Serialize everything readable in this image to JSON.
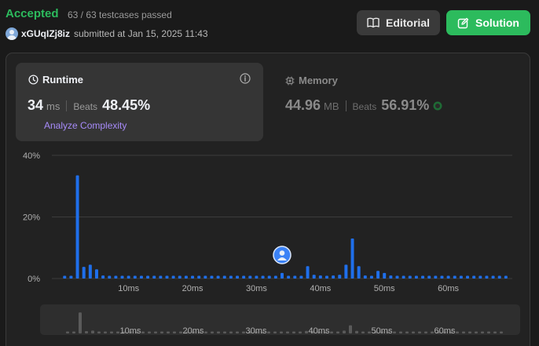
{
  "header": {
    "status": "Accepted",
    "testcases": "63 / 63 testcases passed",
    "username": "xGUqIZj8iz",
    "submitted_text": "submitted at Jan 15, 2025 11:43",
    "editorial_label": "Editorial",
    "solution_label": "Solution"
  },
  "runtime": {
    "title": "Runtime",
    "value": "34",
    "unit": "ms",
    "beats_label": "Beats",
    "beats": "48.45%",
    "analyze_label": "Analyze Complexity"
  },
  "memory": {
    "title": "Memory",
    "value": "44.96",
    "unit": "MB",
    "beats_label": "Beats",
    "beats": "56.91%"
  },
  "colors": {
    "accent_green": "#2cbb5d",
    "bar_blue": "#1f6feb",
    "analyze_purple": "#a78bfa"
  },
  "chart_data": {
    "type": "bar",
    "x": [
      0,
      1,
      2,
      3,
      4,
      5,
      6,
      7,
      8,
      9,
      10,
      11,
      12,
      13,
      14,
      15,
      16,
      17,
      18,
      19,
      20,
      21,
      22,
      23,
      24,
      25,
      26,
      27,
      28,
      29,
      30,
      31,
      32,
      33,
      34,
      35,
      36,
      37,
      38,
      39,
      40,
      41,
      42,
      43,
      44,
      45,
      46,
      47,
      48,
      49,
      50,
      51,
      52,
      53,
      54,
      55,
      56,
      57,
      58,
      59,
      60,
      61,
      62,
      63,
      64,
      65,
      66,
      67,
      68,
      69
    ],
    "values": [
      0.9,
      0.9,
      33.5,
      3.8,
      4.5,
      3.0,
      1.0,
      0.9,
      0.9,
      0.9,
      0.9,
      0.9,
      0.9,
      0.9,
      0.9,
      0.9,
      0.9,
      0.9,
      0.9,
      0.9,
      0.9,
      0.9,
      0.9,
      0.9,
      0.9,
      0.9,
      0.9,
      0.9,
      0.9,
      0.9,
      0.9,
      0.9,
      0.9,
      0.9,
      1.8,
      0.9,
      0.9,
      0.9,
      4.0,
      1.2,
      1.0,
      0.9,
      1.0,
      1.2,
      4.5,
      13.0,
      4.0,
      1.0,
      0.9,
      2.5,
      1.8,
      1.0,
      0.9,
      0.9,
      0.9,
      0.9,
      0.9,
      0.9,
      0.9,
      0.9,
      0.9,
      0.9,
      0.9,
      0.9,
      0.9,
      0.9,
      0.9,
      0.9,
      0.9,
      0.9
    ],
    "yticks": [
      "40%",
      "20%",
      "0%"
    ],
    "ytick_values": [
      40,
      20,
      0
    ],
    "xticks": [
      "10ms",
      "20ms",
      "30ms",
      "40ms",
      "50ms",
      "60ms"
    ],
    "xtick_values": [
      10,
      20,
      30,
      40,
      50,
      60
    ],
    "ylim": [
      0,
      40
    ],
    "xlim": [
      -2,
      70
    ],
    "marker_x": 34,
    "grid": true
  }
}
